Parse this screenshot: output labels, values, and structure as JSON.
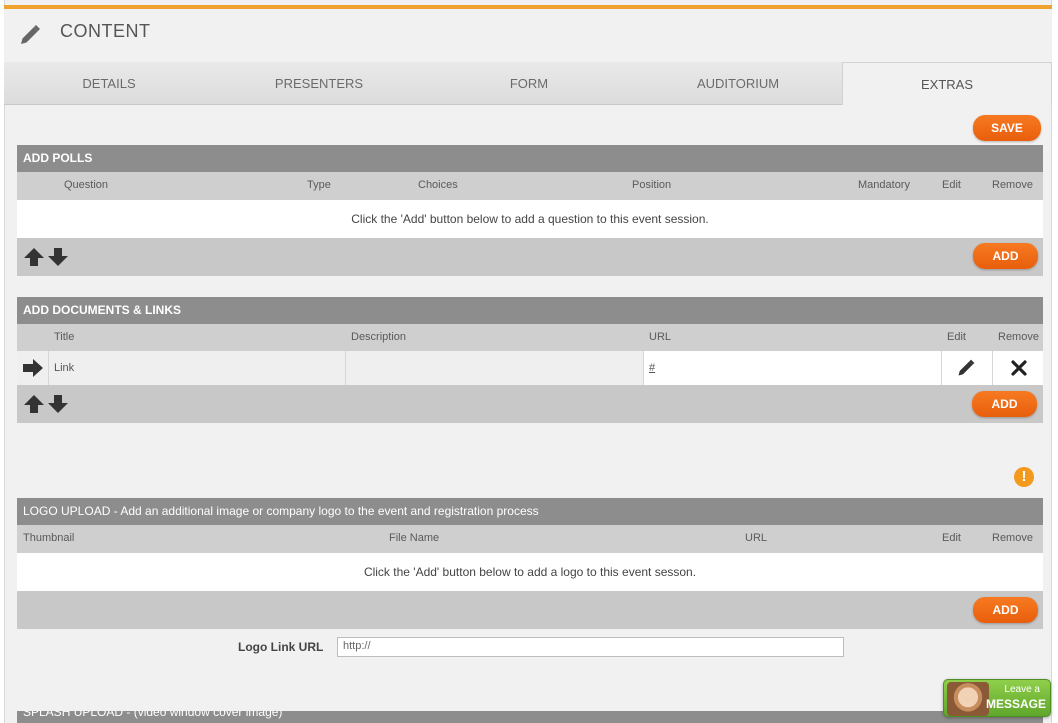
{
  "header": {
    "title": "CONTENT",
    "icon": "pencil-icon"
  },
  "tabs": [
    {
      "label": "DETAILS"
    },
    {
      "label": "PRESENTERS"
    },
    {
      "label": "FORM"
    },
    {
      "label": "AUDITORIUM"
    },
    {
      "label": "EXTRAS",
      "active": true
    }
  ],
  "save_label": "SAVE",
  "polls": {
    "title": "ADD POLLS",
    "columns": [
      "Question",
      "Type",
      "Choices",
      "Position",
      "Mandatory",
      "Edit",
      "Remove"
    ],
    "empty_message": "Click the 'Add' button below to add a question to this event session.",
    "add_label": "ADD"
  },
  "documents": {
    "title": "ADD DOCUMENTS & LINKS",
    "columns": [
      "Title",
      "Description",
      "URL",
      "Edit",
      "Remove"
    ],
    "rows": [
      {
        "title": "Link",
        "description": "",
        "url": "#"
      }
    ],
    "add_label": "ADD"
  },
  "logo": {
    "title": "LOGO UPLOAD - Add an additional image or company logo to the event and registration process",
    "columns": [
      "Thumbnail",
      "File Name",
      "URL",
      "Edit",
      "Remove"
    ],
    "empty_message": "Click the 'Add' button below to add a logo to this event sesson.",
    "add_label": "ADD",
    "link_label": "Logo Link URL",
    "link_value": "http://"
  },
  "splash": {
    "title": "SPLASH UPLOAD - (video window cover image)"
  },
  "chat_widget": {
    "line1": "Leave a",
    "line2": "MESSAGE"
  },
  "colors": {
    "accent": "#f0a22e",
    "button": "#ee6a14",
    "section": "#8d8d8d",
    "warning": "#f39a1e"
  }
}
